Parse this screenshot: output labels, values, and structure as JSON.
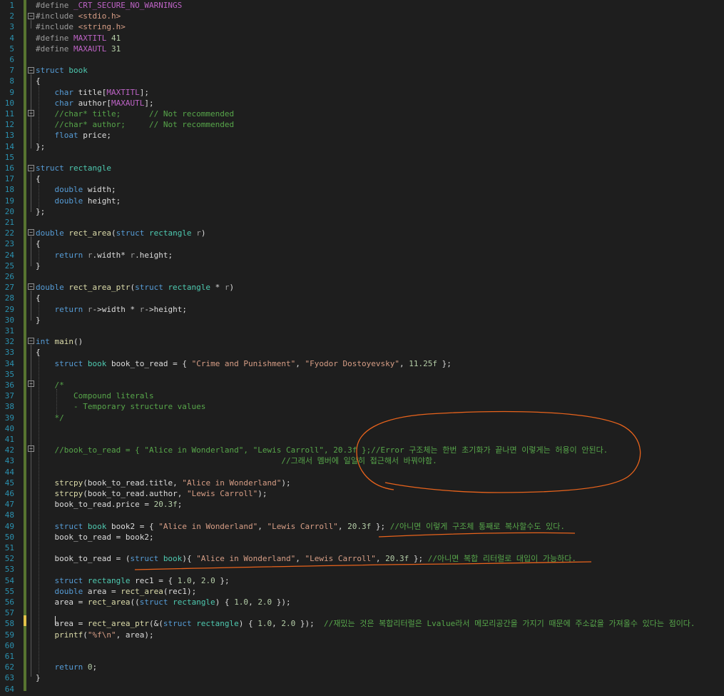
{
  "editor": {
    "lines": [
      [
        [
          "pp",
          "#define "
        ],
        [
          "mac",
          "_CRT_SECURE_NO_WARNINGS"
        ]
      ],
      [
        [
          "pp",
          "#include "
        ],
        [
          "str",
          "<stdio.h>"
        ]
      ],
      [
        [
          "pp",
          "#include "
        ],
        [
          "str",
          "<string.h>"
        ]
      ],
      [
        [
          "pp",
          "#define "
        ],
        [
          "mac",
          "MAXTITL"
        ],
        [
          "num",
          " 41"
        ]
      ],
      [
        [
          "pp",
          "#define "
        ],
        [
          "mac",
          "MAXAUTL"
        ],
        [
          "num",
          " 31"
        ]
      ],
      [],
      [
        [
          "kw",
          "struct "
        ],
        [
          "ty",
          "book"
        ]
      ],
      [
        [
          "p",
          "{"
        ]
      ],
      [
        [
          "p",
          "    "
        ],
        [
          "kw",
          "char "
        ],
        [
          "p",
          "title["
        ],
        [
          "mac",
          "MAXTITL"
        ],
        [
          "p",
          "];"
        ]
      ],
      [
        [
          "p",
          "    "
        ],
        [
          "kw",
          "char "
        ],
        [
          "p",
          "author["
        ],
        [
          "mac",
          "MAXAUTL"
        ],
        [
          "p",
          "];"
        ]
      ],
      [
        [
          "p",
          "    "
        ],
        [
          "cm",
          "//char* title;      // Not recommended"
        ]
      ],
      [
        [
          "p",
          "    "
        ],
        [
          "cm",
          "//char* author;     // Not recommended"
        ]
      ],
      [
        [
          "p",
          "    "
        ],
        [
          "kw",
          "float "
        ],
        [
          "p",
          "price;"
        ]
      ],
      [
        [
          "p",
          "};"
        ]
      ],
      [],
      [
        [
          "kw",
          "struct "
        ],
        [
          "ty",
          "rectangle"
        ]
      ],
      [
        [
          "p",
          "{"
        ]
      ],
      [
        [
          "p",
          "    "
        ],
        [
          "kw",
          "double "
        ],
        [
          "p",
          "width;"
        ]
      ],
      [
        [
          "p",
          "    "
        ],
        [
          "kw",
          "double "
        ],
        [
          "p",
          "height;"
        ]
      ],
      [
        [
          "p",
          "};"
        ]
      ],
      [],
      [
        [
          "kw",
          "double "
        ],
        [
          "fn",
          "rect_area"
        ],
        [
          "p",
          "("
        ],
        [
          "kw",
          "struct "
        ],
        [
          "ty",
          "rectangle "
        ],
        [
          "pr",
          "r"
        ],
        [
          "p",
          ")"
        ]
      ],
      [
        [
          "p",
          "{"
        ]
      ],
      [
        [
          "p",
          "    "
        ],
        [
          "kw",
          "return "
        ],
        [
          "pr",
          "r"
        ],
        [
          "p",
          ".width* "
        ],
        [
          "pr",
          "r"
        ],
        [
          "p",
          ".height;"
        ]
      ],
      [
        [
          "p",
          "}"
        ]
      ],
      [],
      [
        [
          "kw",
          "double "
        ],
        [
          "fn",
          "rect_area_ptr"
        ],
        [
          "p",
          "("
        ],
        [
          "kw",
          "struct "
        ],
        [
          "ty",
          "rectangle "
        ],
        [
          "p",
          "* "
        ],
        [
          "pr",
          "r"
        ],
        [
          "p",
          ")"
        ]
      ],
      [
        [
          "p",
          "{"
        ]
      ],
      [
        [
          "p",
          "    "
        ],
        [
          "kw",
          "return "
        ],
        [
          "pr",
          "r"
        ],
        [
          "p",
          "->width * "
        ],
        [
          "pr",
          "r"
        ],
        [
          "p",
          "->height;"
        ]
      ],
      [
        [
          "p",
          "}"
        ]
      ],
      [],
      [
        [
          "kw",
          "int "
        ],
        [
          "fn",
          "main"
        ],
        [
          "p",
          "()"
        ]
      ],
      [
        [
          "p",
          "{"
        ]
      ],
      [
        [
          "p",
          "    "
        ],
        [
          "kw",
          "struct "
        ],
        [
          "ty",
          "book "
        ],
        [
          "p",
          "book_to_read = { "
        ],
        [
          "str",
          "\"Crime and Punishment\""
        ],
        [
          "p",
          ", "
        ],
        [
          "str",
          "\"Fyodor Dostoyevsky\""
        ],
        [
          "p",
          ", "
        ],
        [
          "num",
          "11.25f"
        ],
        [
          "p",
          " };"
        ]
      ],
      [],
      [
        [
          "p",
          "    "
        ],
        [
          "cm",
          "/*"
        ]
      ],
      [
        [
          "p",
          "    "
        ],
        [
          "cm",
          "    Compound literals"
        ]
      ],
      [
        [
          "p",
          "    "
        ],
        [
          "cm",
          "    - Temporary structure values"
        ]
      ],
      [
        [
          "p",
          "    "
        ],
        [
          "cm",
          "*/"
        ]
      ],
      [],
      [],
      [
        [
          "p",
          "    "
        ],
        [
          "cm",
          "//book_to_read = { \"Alice in Wonderland\", \"Lewis Carroll\", 20.3f };//Error 구조체는 한번 초기화가 끝나면 이렇게는 허용이 안된다."
        ]
      ],
      [
        [
          "p",
          "    "
        ],
        [
          "cm",
          "                                                //그래서 멤버에 일일히 접근해서 바꿔야함."
        ]
      ],
      [],
      [
        [
          "p",
          "    "
        ],
        [
          "fn",
          "strcpy"
        ],
        [
          "p",
          "(book_to_read.title, "
        ],
        [
          "str",
          "\"Alice in Wonderland\""
        ],
        [
          "p",
          ");"
        ]
      ],
      [
        [
          "p",
          "    "
        ],
        [
          "fn",
          "strcpy"
        ],
        [
          "p",
          "(book_to_read.author, "
        ],
        [
          "str",
          "\"Lewis Carroll\""
        ],
        [
          "p",
          ");"
        ]
      ],
      [
        [
          "p",
          "    book_to_read.price = "
        ],
        [
          "num",
          "20.3f"
        ],
        [
          "p",
          ";"
        ]
      ],
      [],
      [
        [
          "p",
          "    "
        ],
        [
          "kw",
          "struct "
        ],
        [
          "ty",
          "book "
        ],
        [
          "p",
          "book2 = { "
        ],
        [
          "str",
          "\"Alice in Wonderland\""
        ],
        [
          "p",
          ", "
        ],
        [
          "str",
          "\"Lewis Carroll\""
        ],
        [
          "p",
          ", "
        ],
        [
          "num",
          "20.3f"
        ],
        [
          "p",
          " }; "
        ],
        [
          "cm",
          "//아니면 이렇게 구조체 통째로 복사할수도 있다."
        ]
      ],
      [
        [
          "p",
          "    book_to_read = book2;"
        ]
      ],
      [],
      [
        [
          "p",
          "    book_to_read = ("
        ],
        [
          "kw",
          "struct "
        ],
        [
          "ty",
          "book"
        ],
        [
          "p",
          ")"
        ],
        [
          "p",
          "{ "
        ],
        [
          "str",
          "\"Alice in Wonderland\""
        ],
        [
          "p",
          ", "
        ],
        [
          "str",
          "\"Lewis Carroll\""
        ],
        [
          "p",
          ", "
        ],
        [
          "num",
          "20.3f"
        ],
        [
          "p",
          " }; "
        ],
        [
          "cm",
          "//아니면 복합 리터럴로 대입이 가능하다."
        ]
      ],
      [],
      [
        [
          "p",
          "    "
        ],
        [
          "kw",
          "struct "
        ],
        [
          "ty",
          "rectangle "
        ],
        [
          "p",
          "rec1 = { "
        ],
        [
          "num",
          "1.0"
        ],
        [
          "p",
          ", "
        ],
        [
          "num",
          "2.0"
        ],
        [
          "p",
          " };"
        ]
      ],
      [
        [
          "p",
          "    "
        ],
        [
          "kw",
          "double "
        ],
        [
          "p",
          "area = "
        ],
        [
          "fn",
          "rect_area"
        ],
        [
          "p",
          "(rec1);"
        ]
      ],
      [
        [
          "p",
          "    area = "
        ],
        [
          "fn",
          "rect_area"
        ],
        [
          "p",
          "(("
        ],
        [
          "kw",
          "struct "
        ],
        [
          "ty",
          "rectangle"
        ],
        [
          "p",
          ") { "
        ],
        [
          "num",
          "1.0"
        ],
        [
          "p",
          ", "
        ],
        [
          "num",
          "2.0"
        ],
        [
          "p",
          " });"
        ]
      ],
      [],
      [
        [
          "p",
          "    area = "
        ],
        [
          "fn",
          "rect_area_ptr"
        ],
        [
          "p",
          "(&("
        ],
        [
          "kw",
          "struct "
        ],
        [
          "ty",
          "rectangle"
        ],
        [
          "p",
          ") { "
        ],
        [
          "num",
          "1.0"
        ],
        [
          "p",
          ", "
        ],
        [
          "num",
          "2.0"
        ],
        [
          "p",
          " });  "
        ],
        [
          "cm",
          "//재밌는 것은 복합리터럴은 Lvalue라서 메모리공간을 가지기 때문에 주소값을 가져올수 있다는 점이다."
        ]
      ],
      [
        [
          "p",
          "    "
        ],
        [
          "fn",
          "printf"
        ],
        [
          "p",
          "("
        ],
        [
          "str",
          "\"%f\\n\""
        ],
        [
          "p",
          ", area);"
        ]
      ],
      [],
      [],
      [
        [
          "p",
          "    "
        ],
        [
          "kw",
          "return "
        ],
        [
          "num",
          "0"
        ],
        [
          "p",
          ";"
        ]
      ],
      [
        [
          "p",
          "}"
        ]
      ],
      []
    ]
  },
  "colors": {
    "keyword": "#569cd6",
    "type": "#4ec9b0",
    "string": "#d69d85",
    "comment": "#57a64a",
    "macro": "#bd63c5",
    "line_number": "#2b91af",
    "annotation_ink": "#e8631c"
  }
}
